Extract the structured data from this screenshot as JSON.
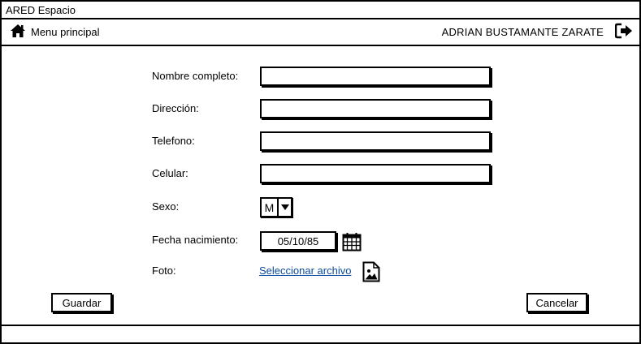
{
  "window": {
    "title": "ARED Espacio"
  },
  "nav": {
    "home_label": "Menu principal",
    "home_icon": "home-icon",
    "user_name": "ADRIAN BUSTAMANTE ZARATE",
    "logout_icon": "logout-icon"
  },
  "form": {
    "nombre_label": "Nombre completo:",
    "nombre_value": "",
    "direccion_label": "Dirección:",
    "direccion_value": "",
    "telefono_label": "Telefono:",
    "telefono_value": "",
    "celular_label": "Celular:",
    "celular_value": "",
    "sexo_label": "Sexo:",
    "sexo_value": "M",
    "fecha_label": "Fecha nacimiento:",
    "fecha_value": "05/10/85",
    "foto_label": "Foto:",
    "foto_link": "Seleccionar archivo"
  },
  "buttons": {
    "save": "Guardar",
    "cancel": "Cancelar"
  }
}
